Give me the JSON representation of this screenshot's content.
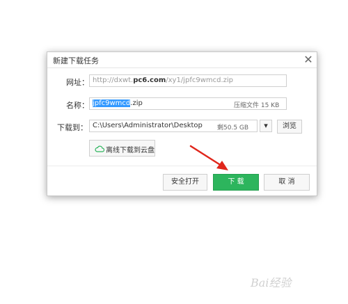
{
  "dialog": {
    "title": "新建下载任务",
    "close_glyph": "✕",
    "url": {
      "label": "网址：",
      "prefix": "http://dxwt.",
      "domain": "pc6.com",
      "suffix": "/xy1/jpfc9wmcd.zip"
    },
    "name": {
      "label": "名称：",
      "selected_part": "jpfc9wmcd",
      "extension": ".zip",
      "file_type_size": "压缩文件 15 KB"
    },
    "download_to": {
      "label": "下载到：",
      "path": "C:\\Users\\Administrator\\Desktop",
      "free_space": "剩50.5 GB",
      "dropdown_glyph": "▾",
      "browse_label": "浏览"
    },
    "cloud_label": "离线下载到云盘",
    "safe_open_label": "安全打开",
    "download_label": "下 载",
    "cancel_label": "取 消"
  },
  "colors": {
    "accent_green": "#2db55d",
    "selection_blue": "#3399ff",
    "annotation_red": "#e0261b"
  },
  "watermark": "Bai经验"
}
